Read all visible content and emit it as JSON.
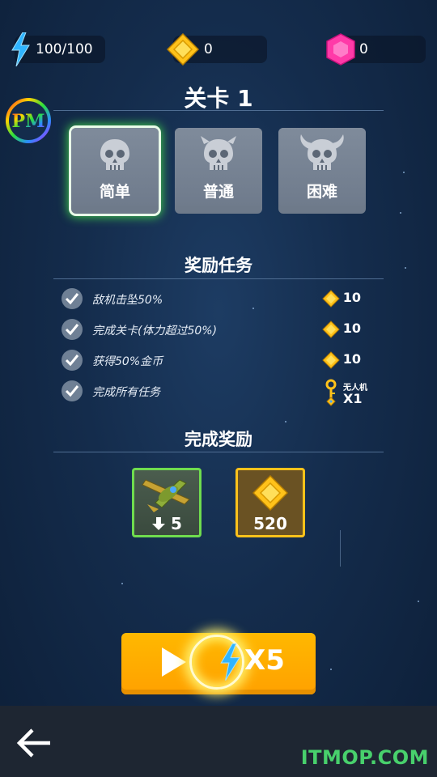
{
  "resources": {
    "energy": {
      "icon": "lightning-icon",
      "value": "100/100"
    },
    "gold": {
      "icon": "gold-diamond-icon",
      "value": "0"
    },
    "gem": {
      "icon": "pink-gem-icon",
      "value": "0"
    }
  },
  "logo": {
    "icon": "pm-logo-icon"
  },
  "level": {
    "title": "关卡 1"
  },
  "difficulties": [
    {
      "label": "简单",
      "icon": "skull-icon",
      "selected": true
    },
    {
      "label": "普通",
      "icon": "horned-skull-icon",
      "selected": false
    },
    {
      "label": "困难",
      "icon": "big-horned-skull-icon",
      "selected": false
    }
  ],
  "tasks": {
    "title": "奖励任务",
    "items": [
      {
        "text": "敌机击坠50%",
        "reward": "10",
        "reward_icon": "gold-coin-icon"
      },
      {
        "text": "完成关卡(体力超过50%)",
        "reward": "10",
        "reward_icon": "gold-coin-icon"
      },
      {
        "text": "获得50%金币",
        "reward": "10",
        "reward_icon": "gold-coin-icon"
      },
      {
        "text": "完成所有任务",
        "reward_label": "无人机",
        "reward": "X1",
        "reward_icon": "key-icon"
      }
    ]
  },
  "completion": {
    "title": "完成奖励",
    "rewards": [
      {
        "icon": "plane-icon",
        "badge_icon": "upgrade-icon",
        "count": "5"
      },
      {
        "icon": "gold-diamond-icon",
        "count": "520"
      }
    ]
  },
  "play": {
    "cost": "X5",
    "icon": "play-icon"
  },
  "footer": {
    "back_icon": "back-arrow-icon",
    "watermark": "ITMOP.COM"
  },
  "colors": {
    "background": "#142c4c",
    "play_button": "#ffaa00",
    "selected_glow": "#3ecb4a",
    "gold": "#ffc21a",
    "gem": "#ff3aa8",
    "energy": "#2fb4ff",
    "watermark": "#48d06c"
  }
}
